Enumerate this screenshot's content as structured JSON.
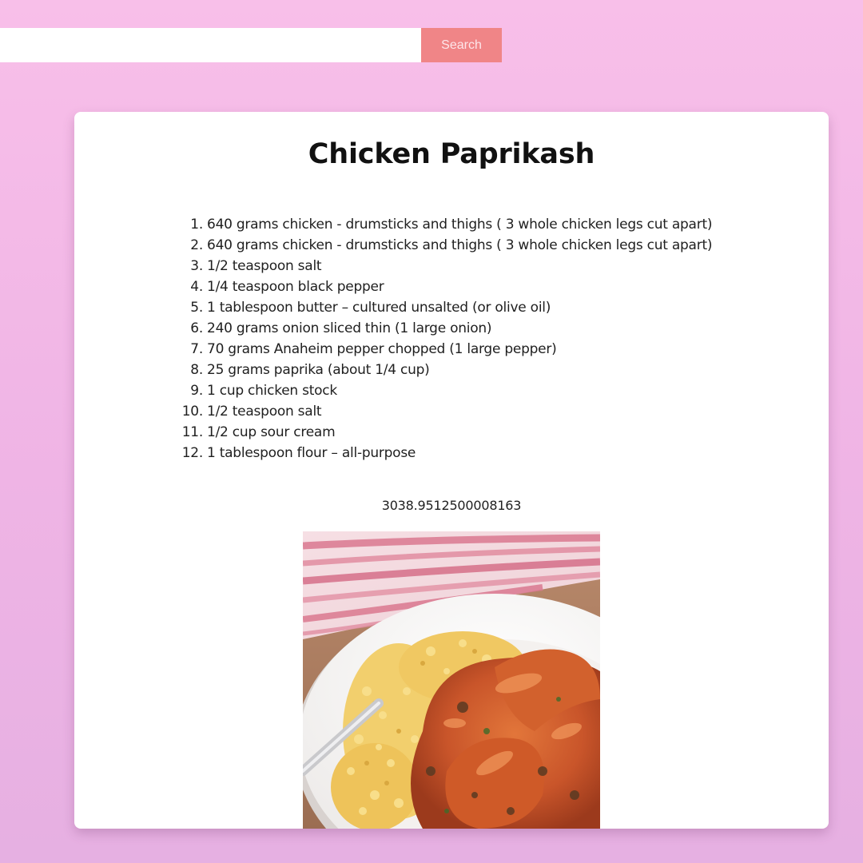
{
  "search": {
    "value": "",
    "placeholder": "",
    "button_label": "Search"
  },
  "recipe": {
    "title": "Chicken Paprikash",
    "ingredients": [
      "640 grams chicken - drumsticks and thighs ( 3 whole chicken legs cut apart)",
      "640 grams chicken - drumsticks and thighs ( 3 whole chicken legs cut apart)",
      "1/2 teaspoon salt",
      "1/4 teaspoon black pepper",
      "1 tablespoon butter – cultured unsalted (or olive oil)",
      "240 grams onion sliced thin (1 large onion)",
      "70 grams Anaheim pepper chopped (1 large pepper)",
      "25 grams paprika (about 1/4 cup)",
      "1 cup chicken stock",
      "1/2 teaspoon salt",
      "1/2 cup sour cream",
      "1 tablespoon flour – all-purpose"
    ],
    "number": "3038.9512500008163"
  },
  "colors": {
    "background_top": "#f8bfe9",
    "background_bottom": "#e6b0e2",
    "search_button": "#f08587",
    "card": "#ffffff"
  },
  "icons": {
    "photo": "chicken-paprikash-photo"
  }
}
